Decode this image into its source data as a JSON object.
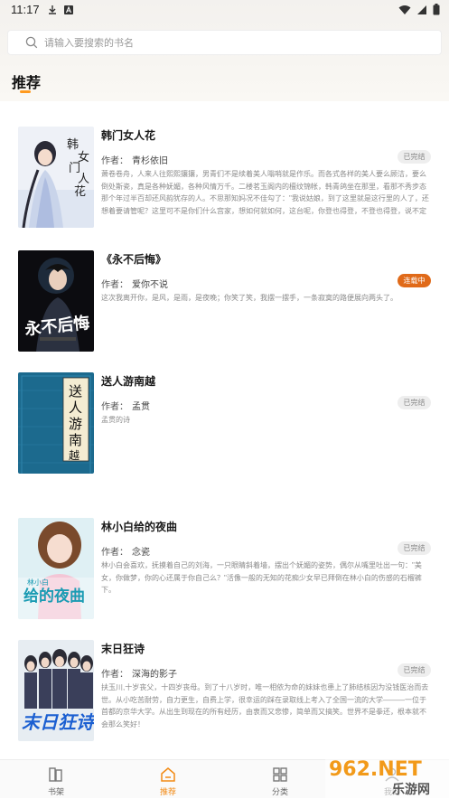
{
  "status_bar": {
    "time": "11:17"
  },
  "search": {
    "placeholder": "请输入要搜索的书名"
  },
  "section": {
    "title": "推荐"
  },
  "books": [
    {
      "title": "韩门女人花",
      "author_label": "作者：",
      "author": "青杉依旧",
      "status": "已完结",
      "description": "萧卷卷舟，人来人往熙熙攘攘，男青们不是续着美人嗡哨就是作乐。而各式各样的美人要么顾洁，要么倒处斯瓷，真是各种妩媚，各种风情万千。二楼茗玉阁内的檀纹锦帐，韩青鸽坐在那里，看那不秀步态那个年过半百却还风韵犹存的人。不思那知妈况不佳勾了：\"我说姑娘，到了这里就是这行里的人了，还想着要请管呢？这里可不是你们什么宫家，想如何就如何，这台呢，你登也得登，不登也得登，说不定你登了台，被哪家有钱的官人或富商看中，还能带回去做第几房太太。这个也是一条出路。\""
    },
    {
      "title": "《永不后悔》",
      "author_label": "作者：",
      "author": "爱你不说",
      "status": "连载中",
      "description": "这次我离开你，是风，是雨，是夜晚；你笑了笑，我摆一摆手，一条寂寞的路便展向两头了。"
    },
    {
      "title": "送人游南越",
      "author_label": "作者：",
      "author": "孟贯",
      "status": "已完结",
      "description": "孟贯的诗"
    },
    {
      "title": "林小白给的夜曲",
      "author_label": "作者：",
      "author": "念瓷",
      "status": "已完结",
      "description": "林小白会喜欢，抚摸着自己的刘海，一只眼睛斜着墙，摆出个妩媚的姿势，偶尔从嘴里吐出一句：\"美女，你做梦，你的心还属于你自己么？\"活像一般的无知的花痴少女早已拜倒在林小白的伤感的石榴裤下。"
    },
    {
      "title": "末日狂诗",
      "author_label": "作者：",
      "author": "深海的影子",
      "status": "已完结",
      "description": "扶玉川,十岁丧父，十四岁丧母。到了十八岁时，唯一相依为命的妹妹也患上了肺结核因为没钱医治而去世。从小吃苦耐劳，自力更生，自费上学，很幸运的踩在录取线上考入了全国一流的大学———一位于首都的京华大学。从出生到现在的所有经历，由衷而又悲惨，简单而又搞笑。世界不是拳还，根本就不会那么笑好！"
    }
  ],
  "tabs": [
    {
      "label": "书架",
      "icon": "bookshelf-icon"
    },
    {
      "label": "推荐",
      "icon": "home-icon"
    },
    {
      "label": "分类",
      "icon": "grid-icon"
    },
    {
      "label": "我的",
      "icon": "user-icon"
    }
  ],
  "watermark": {
    "text": "962.NET",
    "subtext": "乐游网"
  },
  "colors": {
    "accent": "#f28a14",
    "serial_badge": "#e06a19"
  }
}
